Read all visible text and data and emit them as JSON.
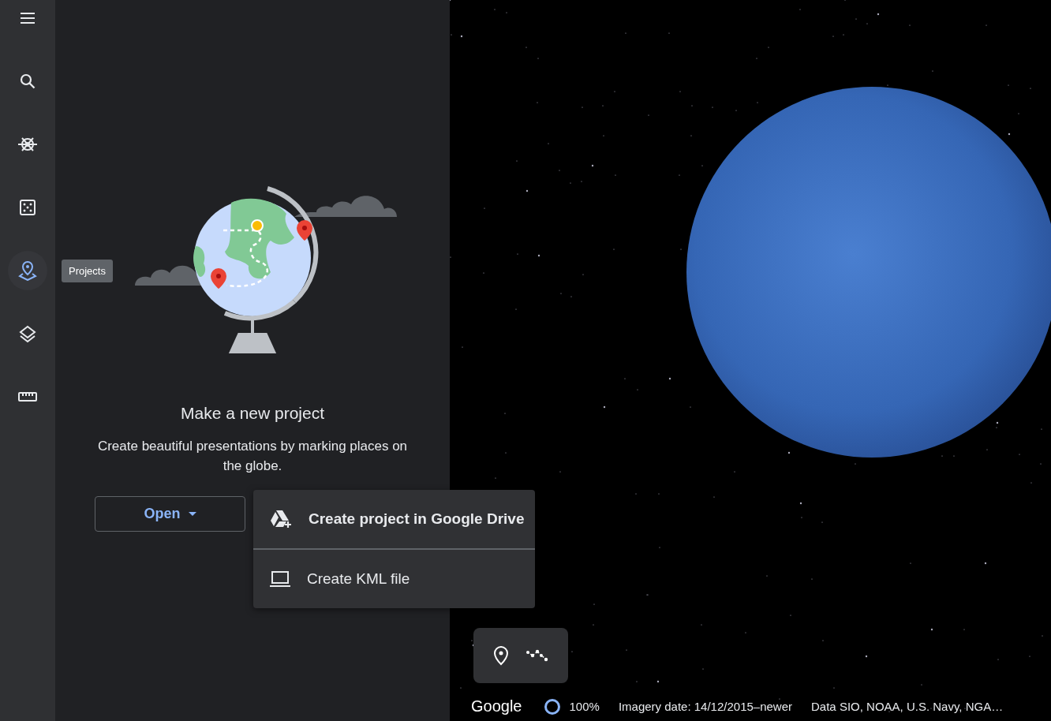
{
  "rail": {
    "items": [
      {
        "kind": "menu",
        "selected": false
      },
      {
        "kind": "search",
        "selected": false
      },
      {
        "kind": "wheel",
        "selected": false
      },
      {
        "kind": "dice",
        "selected": false
      },
      {
        "kind": "projects",
        "selected": true
      },
      {
        "kind": "layers",
        "selected": false
      },
      {
        "kind": "ruler",
        "selected": false
      }
    ]
  },
  "tooltip": {
    "label": "Projects"
  },
  "panel": {
    "title": "Make a new project",
    "description": "Create beautiful presentations by marking places on the globe.",
    "open_button": {
      "label": "Open"
    }
  },
  "menu": {
    "items": [
      {
        "kind": "drive",
        "label": "Create project in Google Drive"
      },
      {
        "kind": "computer",
        "label": "Create KML file"
      }
    ]
  },
  "map_tools": [
    {
      "kind": "placemark"
    },
    {
      "kind": "path"
    }
  ],
  "status_bar": {
    "logo": "Google",
    "zoom": "100%",
    "imagery_date": "Imagery date: 14/12/2015–newer",
    "attribution": "Data SIO, NOAA, U.S. Navy, NGA…"
  }
}
